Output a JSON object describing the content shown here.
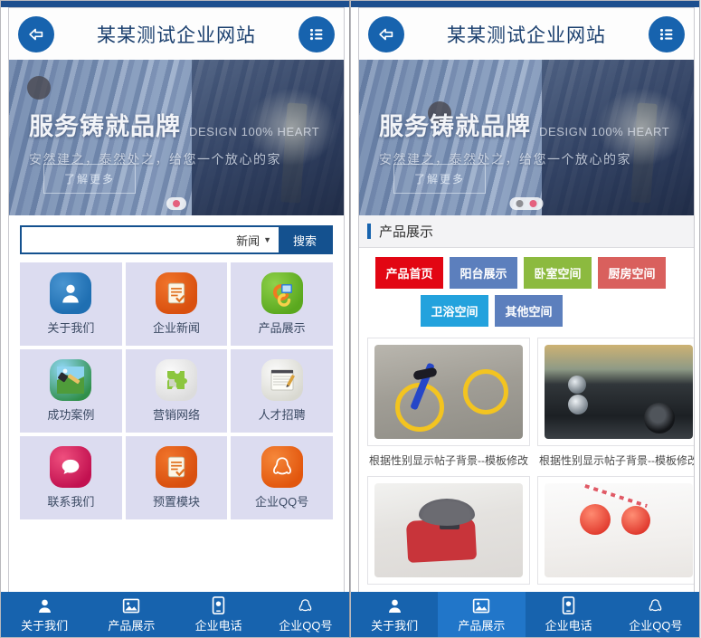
{
  "theme": {
    "brand_blue": "#1763ae",
    "dark_blue": "#14518f",
    "accent_pink": "#e4607e",
    "cell_bg": "#dcdcf0"
  },
  "header": {
    "title": "某某测试企业网站",
    "back_icon": "back-arrow-icon",
    "menu_icon": "hamburger-list-icon"
  },
  "banner": {
    "title": "服务铸就品牌",
    "subtitle_en": "DESIGN 100% HEART",
    "tagline": "安然建之，泰然处之，给您一个放心的家",
    "cta_label": "了解更多",
    "left_dots": 1,
    "right_dots": 2,
    "active_dot_index": 0
  },
  "search": {
    "value": "",
    "placeholder": "",
    "category_label": "新闻",
    "caret": "▼",
    "button_label": "搜索"
  },
  "icon_grid": [
    {
      "label": "关于我们",
      "icon": "person-icon",
      "style": "sq-about"
    },
    {
      "label": "企业新闻",
      "icon": "news-clipboard-icon",
      "style": "sq-news"
    },
    {
      "label": "产品展示",
      "icon": "product-go-icon",
      "style": "sq-prod"
    },
    {
      "label": "成功案例",
      "icon": "paint-brush-icon",
      "style": "sq-case"
    },
    {
      "label": "营销网络",
      "icon": "puzzle-piece-icon",
      "style": "sq-net"
    },
    {
      "label": "人才招聘",
      "icon": "pen-notepad-icon",
      "style": "sq-hr"
    },
    {
      "label": "联系我们",
      "icon": "chat-bubble-icon",
      "style": "sq-contact"
    },
    {
      "label": "预置模块",
      "icon": "news-clipboard-icon",
      "style": "sq-news"
    },
    {
      "label": "企业QQ号",
      "icon": "qq-penguin-icon",
      "style": "sq-qq"
    }
  ],
  "product_section": {
    "heading": "产品展示",
    "categories": [
      {
        "label": "产品首页",
        "color": "#e20613",
        "active": true
      },
      {
        "label": "阳台展示",
        "color": "#5c7fbd",
        "active": false
      },
      {
        "label": "卧室空间",
        "color": "#8cba3f",
        "active": false
      },
      {
        "label": "厨房空间",
        "color": "#d9605d",
        "active": false
      },
      {
        "label": "卫浴空间",
        "color": "#23a2dd",
        "active": false
      },
      {
        "label": "其他空间",
        "color": "#5c7fbd",
        "active": false
      }
    ],
    "products": [
      {
        "caption": "根据性别显示帖子背景--模板修改",
        "thumb": "bicycle-photo",
        "style": "th-bike"
      },
      {
        "caption": "根据性别显示帖子背景--模板修改",
        "thumb": "classic-car-photo",
        "style": "th-car"
      },
      {
        "caption": "",
        "thumb": "woman-in-hat-photo",
        "style": "th-hat"
      },
      {
        "caption": "",
        "thumb": "red-drinks-photo",
        "style": "th-drink"
      }
    ]
  },
  "bottom_nav": {
    "left": [
      {
        "label": "关于我们",
        "icon": "person-icon",
        "active": false
      },
      {
        "label": "产品展示",
        "icon": "image-icon",
        "active": false
      },
      {
        "label": "企业电话",
        "icon": "mobile-phone-icon",
        "active": false
      },
      {
        "label": "企业QQ号",
        "icon": "qq-penguin-icon",
        "active": false
      }
    ],
    "right": [
      {
        "label": "关于我们",
        "icon": "person-icon",
        "active": false
      },
      {
        "label": "产品展示",
        "icon": "image-icon",
        "active": true
      },
      {
        "label": "企业电话",
        "icon": "mobile-phone-icon",
        "active": false
      },
      {
        "label": "企业QQ号",
        "icon": "qq-penguin-icon",
        "active": false
      }
    ]
  }
}
